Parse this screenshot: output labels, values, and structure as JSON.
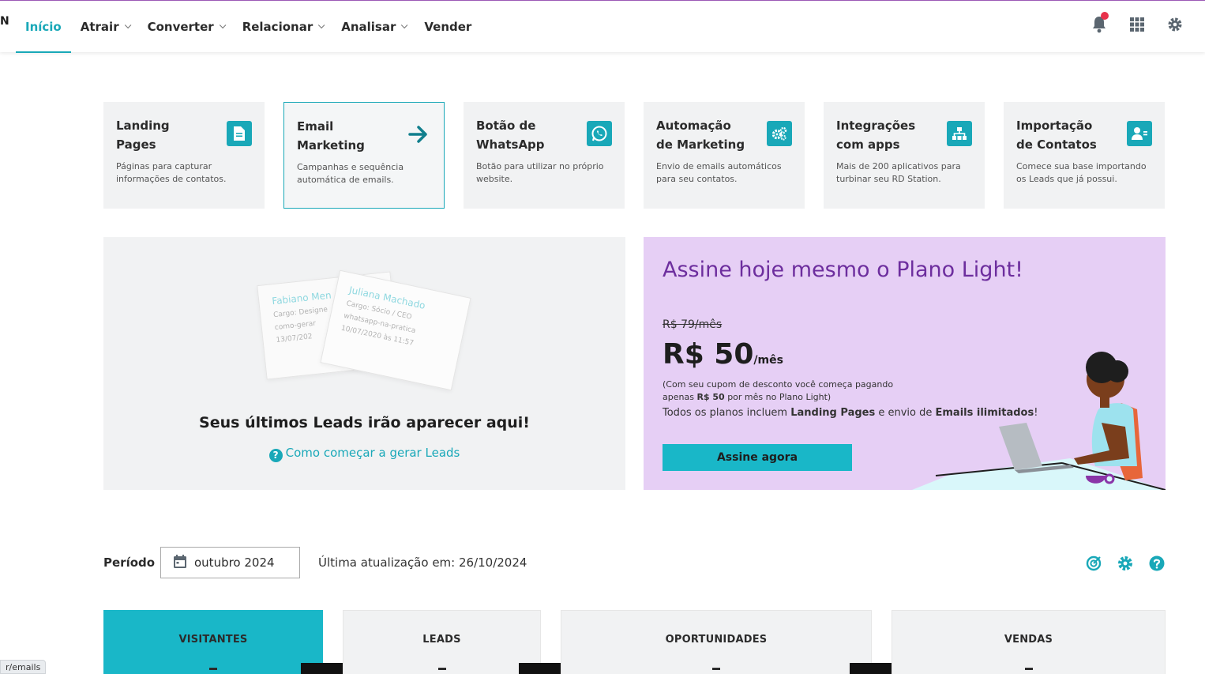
{
  "header": {
    "logo_fragment": "N",
    "nav": [
      {
        "label": "Início",
        "active": true,
        "has_dropdown": false
      },
      {
        "label": "Atrair",
        "active": false,
        "has_dropdown": true
      },
      {
        "label": "Converter",
        "active": false,
        "has_dropdown": true
      },
      {
        "label": "Relacionar",
        "active": false,
        "has_dropdown": true
      },
      {
        "label": "Analisar",
        "active": false,
        "has_dropdown": true
      },
      {
        "label": "Vender",
        "active": false,
        "has_dropdown": false
      }
    ],
    "icons": [
      "bell-icon",
      "apps-grid-icon",
      "gear-icon"
    ],
    "notification_dot_color": "#e8324b"
  },
  "feature_cards": [
    {
      "title": "Landing Pages",
      "desc": "Páginas para capturar informações de contatos.",
      "icon": "document-icon",
      "selected": false
    },
    {
      "title": "Email Marketing",
      "desc": "Campanhas e sequência automática de emails.",
      "icon": "arrow-right-icon",
      "selected": true
    },
    {
      "title": "Botão de WhatsApp",
      "desc": "Botão para utilizar no próprio website.",
      "icon": "whatsapp-icon",
      "selected": false
    },
    {
      "title": "Automação de Marketing",
      "desc": "Envio de emails automáticos para seu contatos.",
      "icon": "gears-icon",
      "selected": false
    },
    {
      "title": "Integrações com apps",
      "desc": "Mais de 200 aplicativos para turbinar seu RD Station.",
      "icon": "sitemap-icon",
      "selected": false
    },
    {
      "title": "Importação de Contatos",
      "desc": "Comece sua base importando os Leads que já possui.",
      "icon": "user-import-icon",
      "selected": false
    }
  ],
  "leads_panel": {
    "card_back": {
      "name": "Fabiano Men",
      "role": "Cargo: Designe",
      "source": "como-gerar",
      "date": "13/07/202"
    },
    "card_front": {
      "name": "Juliana Machado",
      "role": "Cargo: Sócio / CEO",
      "source": "whatsapp-na-pratica",
      "date": "10/07/2020 às 11:57"
    },
    "title": "Seus últimos Leads irão aparecer aqui!",
    "link": "Como começar a gerar Leads"
  },
  "promo": {
    "title": "Assine hoje mesmo o Plano Light!",
    "old_price": "R$ 79/mês",
    "new_price": "R$ 50",
    "new_price_unit": "/mês",
    "note_1": "(Com seu cupom de desconto você começa pagando apenas ",
    "note_bold": "R$ 50",
    "note_2": " por mês no Plano Light)",
    "info_1": "Todos os planos incluem ",
    "info_bold_1": "Landing Pages",
    "info_2": " e envio de ",
    "info_bold_2": "Emails ilimitados",
    "info_3": "!",
    "button": "Assine agora",
    "accent": "#6d2e9e",
    "background": "#e6cff5"
  },
  "period": {
    "label": "Período",
    "value": "outubro 2024",
    "last_update": "Última atualização em: 26/10/2024",
    "icons": [
      "target-icon",
      "gear-icon",
      "help-icon"
    ]
  },
  "stats": [
    {
      "label": "VISITANTES",
      "active": true
    },
    {
      "label": "LEADS",
      "active": false
    },
    {
      "label": "OPORTUNIDADES",
      "active": false
    },
    {
      "label": "VENDAS",
      "active": false
    }
  ],
  "status_bar": {
    "url": "r/emails"
  },
  "colors": {
    "primary": "#19a8b8",
    "button": "#19b7c8",
    "card_bg": "#f1f2f3"
  }
}
